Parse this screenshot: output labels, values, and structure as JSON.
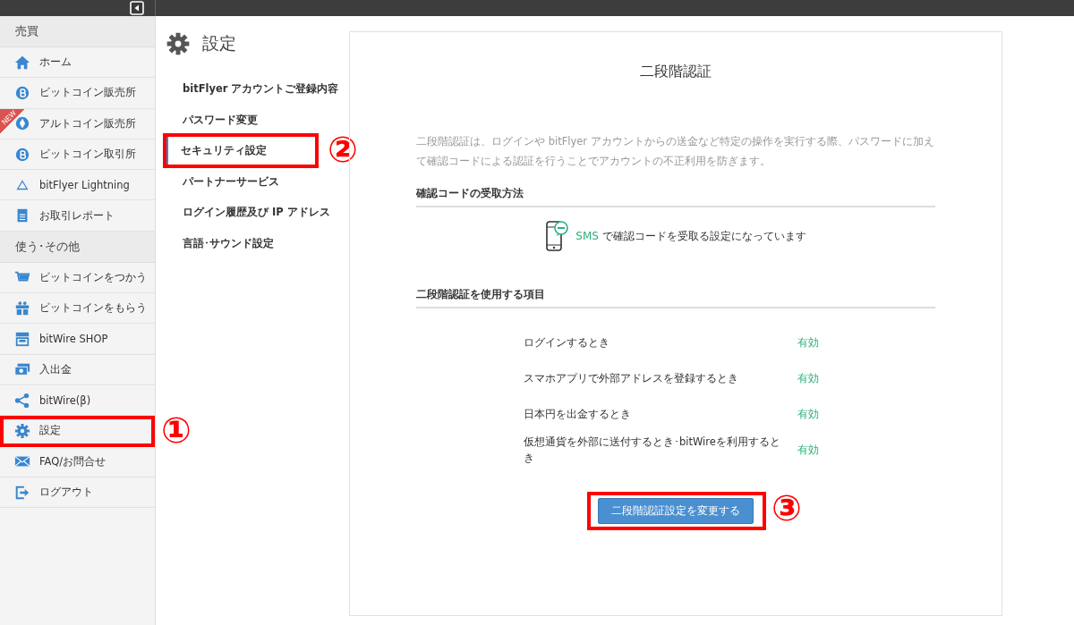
{
  "sidebar": {
    "sections": [
      {
        "title": "売買",
        "items": [
          {
            "label": "ホーム"
          },
          {
            "label": "ビットコイン販売所"
          },
          {
            "label": "アルトコイン販売所",
            "badge": "NEW"
          },
          {
            "label": "ビットコイン取引所"
          },
          {
            "label": "bitFlyer Lightning"
          },
          {
            "label": "お取引レポート"
          }
        ]
      },
      {
        "title": "使う･その他",
        "items": [
          {
            "label": "ビットコインをつかう"
          },
          {
            "label": "ビットコインをもらう"
          },
          {
            "label": "bitWire SHOP"
          },
          {
            "label": "入出金"
          },
          {
            "label": "bitWire(β)"
          },
          {
            "label": "設定",
            "callout": "①"
          },
          {
            "label": "FAQ/お問合せ"
          },
          {
            "label": "ログアウト"
          }
        ]
      }
    ]
  },
  "settings_menu": {
    "title": "設定",
    "items": [
      {
        "label": "bitFlyer アカウントご登録内容",
        "selected": false
      },
      {
        "label": "パスワード変更",
        "selected": false
      },
      {
        "label": "セキュリティ設定",
        "selected": true,
        "callout": "②"
      },
      {
        "label": "パートナーサービス",
        "selected": false
      },
      {
        "label": "ログイン履歴及び IP アドレス",
        "selected": false
      },
      {
        "label": "言語･サウンド設定",
        "selected": false
      }
    ]
  },
  "panel": {
    "title": "二段階認証",
    "description": "二段階認証は、ログインや bitFlyer アカウントからの送金など特定の操作を実行する際、パスワードに加えて確認コードによる認証を行うことでアカウントの不正利用を防ぎます。",
    "method_heading": "確認コードの受取方法",
    "method": {
      "name": "SMS",
      "text": "で確認コードを受取る設定になっています"
    },
    "usage_heading": "二段階認証を使用する項目",
    "usage": [
      {
        "label": "ログインするとき",
        "status": "有効",
        "enabled": true
      },
      {
        "label": "スマホアプリで外部アドレスを登録するとき",
        "status": "有効",
        "enabled": true
      },
      {
        "label": "日本円を出金するとき",
        "status": "有効",
        "enabled": true
      },
      {
        "label": "仮想通貨を外部に送付するとき･bitWireを利用するとき",
        "status": "有効",
        "enabled": true
      }
    ],
    "button": {
      "label": "二段階認証設定を変更する",
      "callout": "③"
    }
  }
}
